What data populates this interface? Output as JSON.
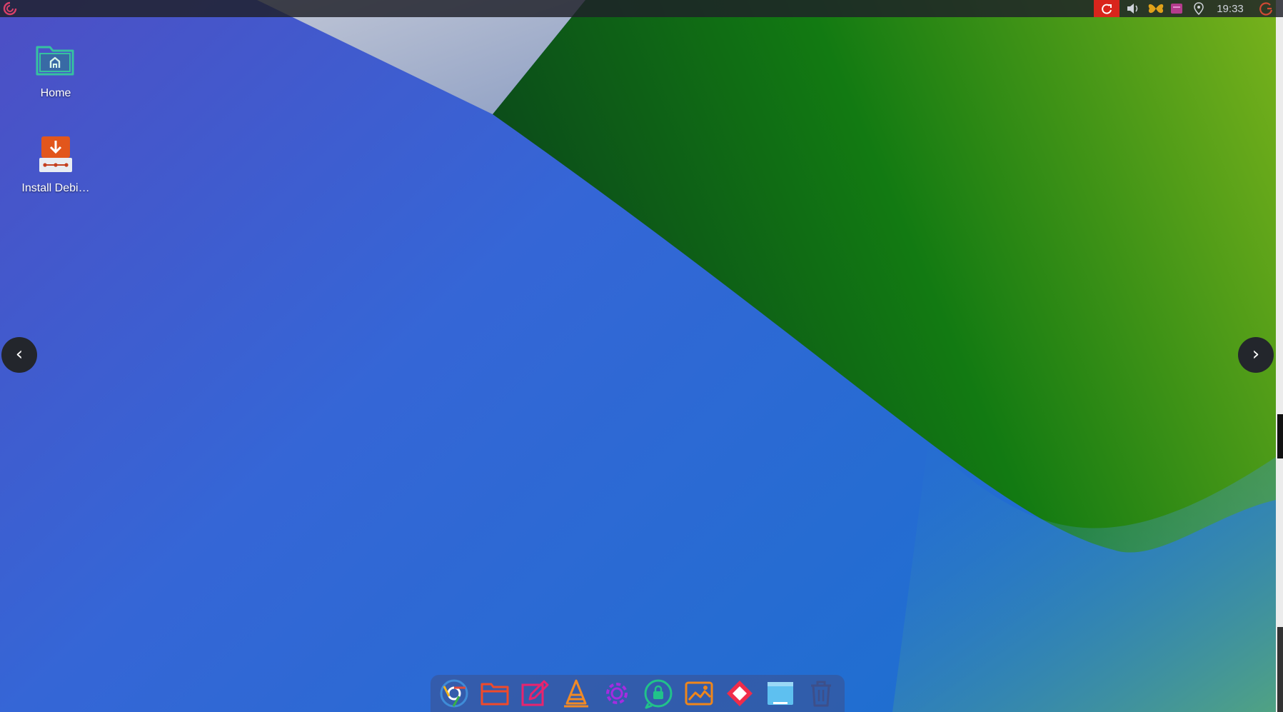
{
  "panel": {
    "clock": "19:33",
    "tray": [
      "notification-icon",
      "volume-icon",
      "butterfly-icon",
      "window-icon",
      "location-icon",
      "power-icon"
    ]
  },
  "desktop": {
    "icons": [
      {
        "label": "Home",
        "icon": "home-folder-icon"
      },
      {
        "label": "Install Debi…",
        "icon": "installer-icon"
      }
    ]
  },
  "navigation": {
    "prev": "‹",
    "next": "›"
  },
  "dock": {
    "items": [
      "chrome-icon",
      "files-icon",
      "text-editor-icon",
      "vlc-icon",
      "settings-icon",
      "store-icon",
      "image-viewer-icon",
      "diamond-app-icon",
      "desktop-icon",
      "trash-icon"
    ]
  },
  "colors": {
    "wallpaper_blue": "#3566d6",
    "wallpaper_violet": "#4f52c6",
    "wallpaper_green": "#1f7a12",
    "wallpaper_lime": "#7fb522",
    "tray_red": "#d9251c",
    "panel_bg": "#1e2028"
  }
}
